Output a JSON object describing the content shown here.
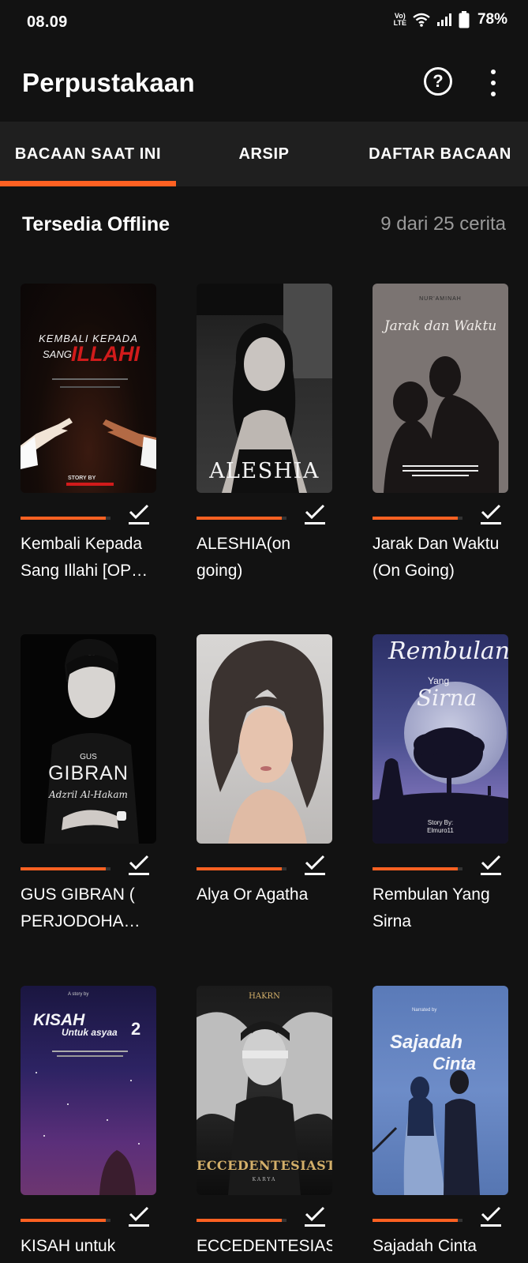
{
  "status_bar": {
    "time": "08.09",
    "volte": "Vo) LTE",
    "battery": "78%"
  },
  "app_bar": {
    "title": "Perpustakaan",
    "help_symbol": "?"
  },
  "tabs": [
    {
      "label": "BACAAN SAAT INI",
      "active": true
    },
    {
      "label": "ARSIP",
      "active": false
    },
    {
      "label": "DAFTAR BACAAN",
      "active": false
    }
  ],
  "section": {
    "title": "Tersedia Offline",
    "count": "9 dari 25 cerita"
  },
  "books": [
    {
      "title": "Kembali Kepada Sang Illahi [OP…",
      "progress": 0.95,
      "downloaded": true,
      "cover": {
        "line1": "KEMBALI KEPADA",
        "line2": "SANG",
        "line3": "ILLAHI",
        "credit": "STORY BY"
      }
    },
    {
      "title": "ALESHIA(on going)",
      "progress": 0.95,
      "downloaded": true,
      "cover": {
        "line1": "ALESHIA"
      }
    },
    {
      "title": "Jarak Dan Waktu (On Going)",
      "progress": 0.95,
      "downloaded": true,
      "cover": {
        "author": "NUR'AMINAH",
        "line1": "Jarak dan Waktu"
      }
    },
    {
      "title": "GUS GIBRAN ( PERJODOHA…",
      "progress": 0.95,
      "downloaded": true,
      "cover": {
        "line0": "GUS",
        "line1": "GIBRAN",
        "line2": "Adzril Al-Hakam"
      }
    },
    {
      "title": "Alya Or Agatha",
      "progress": 0.95,
      "downloaded": true,
      "cover": {}
    },
    {
      "title": "Rembulan Yang Sirna",
      "progress": 0.95,
      "downloaded": true,
      "cover": {
        "line1": "Rembulan",
        "line2": "Yang",
        "line3": "Sirna",
        "credit": "Story By:",
        "author": "Elmuro11"
      }
    },
    {
      "title": "KISAH untuk",
      "progress": 0.95,
      "downloaded": true,
      "cover": {
        "top": "A story by",
        "line1": "KISAH",
        "line2": "Untuk asyaa",
        "num": "2"
      }
    },
    {
      "title": "ECCEDENTESIAS",
      "progress": 0.95,
      "downloaded": true,
      "cover": {
        "top": "HAKRN",
        "line1": "ECCEDENTESIAST",
        "sub": "KARYA"
      }
    },
    {
      "title": "Sajadah Cinta",
      "progress": 0.95,
      "downloaded": true,
      "cover": {
        "top": "Narrated by",
        "line1": "Sajadah",
        "line2": "Cinta"
      }
    }
  ],
  "colors": {
    "accent": "#ff6122",
    "background": "#121212",
    "tabbar": "#1f1f1f"
  },
  "icons": [
    "volte-icon",
    "wifi-icon",
    "signal-icon",
    "battery-icon",
    "help-icon",
    "more-vert-icon",
    "check-download-icon"
  ]
}
